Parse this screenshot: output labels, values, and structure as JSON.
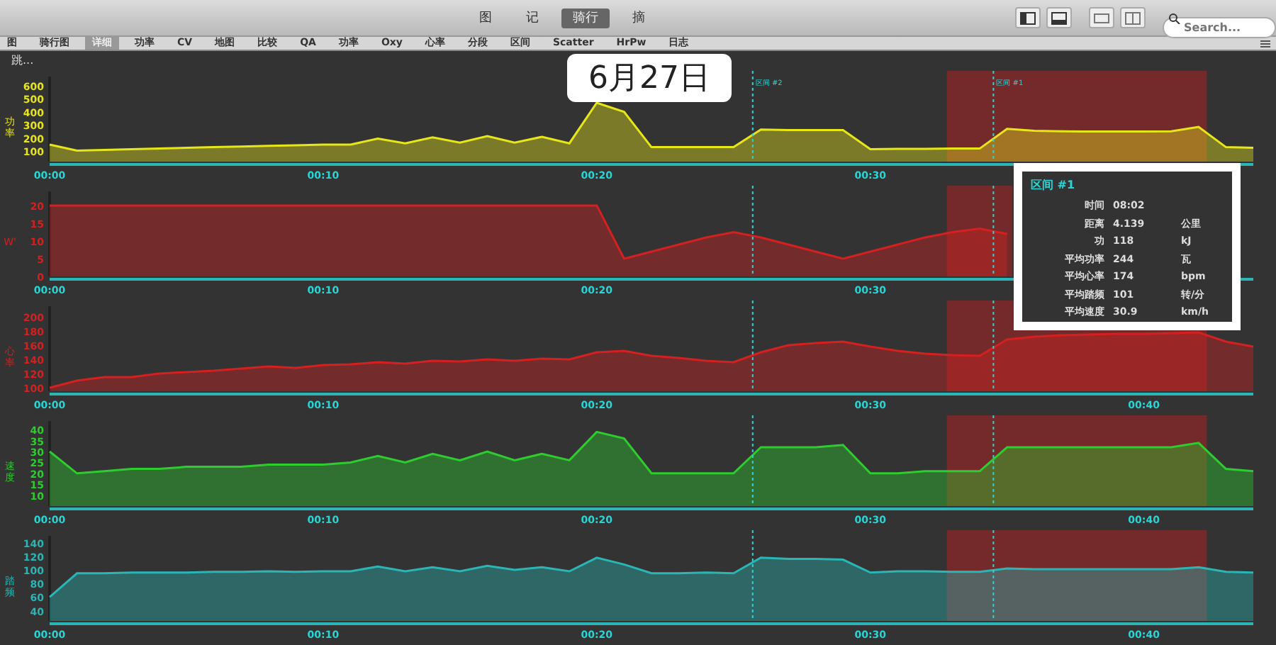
{
  "toolbar": {
    "tabs": [
      {
        "label": "图",
        "selected": false
      },
      {
        "label": "记",
        "selected": false
      },
      {
        "label": "骑行",
        "selected": true
      },
      {
        "label": "摘",
        "selected": false
      }
    ],
    "search": {
      "placeholder": "Search..."
    }
  },
  "menu_bar": {
    "items": [
      {
        "label": "图",
        "selected": false
      },
      {
        "label": "骑行图",
        "selected": false
      },
      {
        "label": "详细",
        "selected": true
      },
      {
        "label": "功率",
        "selected": false
      },
      {
        "label": "CV",
        "selected": false
      },
      {
        "label": "地图",
        "selected": false
      },
      {
        "label": "比较",
        "selected": false
      },
      {
        "label": "QA",
        "selected": false
      },
      {
        "label": "功率",
        "selected": false
      },
      {
        "label": "Oxy",
        "selected": false
      },
      {
        "label": "心率",
        "selected": false
      },
      {
        "label": "分段",
        "selected": false
      },
      {
        "label": "区间",
        "selected": false
      },
      {
        "label": "Scatter",
        "selected": false
      },
      {
        "label": "HrPw",
        "selected": false
      },
      {
        "label": "日志",
        "selected": false
      }
    ]
  },
  "status_text": "跳...",
  "date_label": "6月27日",
  "charts": [
    {
      "chart_data": {
        "type": "area",
        "x": [
          0,
          1,
          2,
          3,
          4,
          5,
          6,
          7,
          8,
          9,
          10,
          11,
          12,
          13,
          14,
          15,
          16,
          17,
          18,
          19,
          20,
          21,
          22,
          23,
          24,
          25,
          26,
          27,
          28,
          29,
          30,
          31,
          32,
          33,
          34,
          35,
          36,
          37,
          38,
          39,
          40,
          41,
          42,
          43,
          44
        ],
        "xlim": [
          0,
          44
        ],
        "ylim": [
          20,
          670
        ],
        "yticks": [
          100,
          200,
          300,
          400,
          500,
          600
        ],
        "xticks": [
          {
            "value": 0,
            "label": "00:00"
          },
          {
            "value": 10,
            "label": "00:10"
          },
          {
            "value": 20,
            "label": "00:20"
          },
          {
            "value": 30,
            "label": "00:30"
          }
        ],
        "series": [
          {
            "name": "功率",
            "color": "#e6e619",
            "values": [
              150,
              105,
              110,
              115,
              120,
              125,
              130,
              135,
              140,
              145,
              150,
              150,
              195,
              160,
              205,
              165,
              215,
              165,
              210,
              160,
              470,
              400,
              130,
              130,
              132,
              130,
              265,
              262,
              260,
              262,
              115,
              118,
              118,
              120,
              120,
              270,
              255,
              252,
              250,
              250,
              250,
              252,
              285,
              130,
              125
            ]
          }
        ],
        "bands": [
          {
            "axis": "x",
            "from": 32.8,
            "to": 42.3
          }
        ],
        "ref_lines": [
          {
            "axis": "x",
            "value": 25.7,
            "label": "区间 #2"
          },
          {
            "axis": "x",
            "value": 34.5,
            "label": "区间 #1"
          }
        ]
      }
    },
    {
      "chart_data": {
        "type": "area",
        "x": [
          0,
          1,
          2,
          3,
          4,
          5,
          6,
          7,
          8,
          9,
          10,
          11,
          12,
          13,
          14,
          15,
          16,
          17,
          18,
          19,
          20,
          21,
          22,
          23,
          24,
          25,
          26,
          27,
          28,
          29,
          30,
          31,
          32,
          33,
          34,
          35
        ],
        "xlim": [
          0,
          44
        ],
        "ylim": [
          0,
          24
        ],
        "yticks": [
          0,
          5,
          10,
          15,
          20
        ],
        "xticks": [
          {
            "value": 0,
            "label": "00:00"
          },
          {
            "value": 10,
            "label": "00:10"
          },
          {
            "value": 20,
            "label": "00:20"
          },
          {
            "value": 30,
            "label": "00:30"
          }
        ],
        "series": [
          {
            "name": "W'",
            "color": "#d42020",
            "values": [
              20,
              20,
              20,
              20,
              20,
              20,
              20,
              20,
              20,
              20,
              20,
              20,
              20,
              20,
              20,
              20,
              20,
              20,
              20,
              20,
              20,
              5,
              7,
              9,
              11,
              12.5,
              11,
              9,
              7,
              5,
              7,
              9,
              11,
              12.5,
              13.5,
              12
            ]
          }
        ],
        "bands": [
          {
            "axis": "x",
            "from": 32.8,
            "to": 35.2
          }
        ],
        "ref_lines": [
          {
            "axis": "x",
            "value": 25.7
          },
          {
            "axis": "x",
            "value": 34.5
          }
        ]
      }
    },
    {
      "chart_data": {
        "type": "area",
        "x": [
          0,
          1,
          2,
          3,
          4,
          5,
          6,
          7,
          8,
          9,
          10,
          11,
          12,
          13,
          14,
          15,
          16,
          17,
          18,
          19,
          20,
          21,
          22,
          23,
          24,
          25,
          26,
          27,
          28,
          29,
          30,
          31,
          32,
          33,
          34,
          35,
          36,
          37,
          38,
          39,
          40,
          41,
          42,
          43,
          44
        ],
        "xlim": [
          0,
          44
        ],
        "ylim": [
          95,
          215
        ],
        "yticks": [
          100,
          120,
          140,
          160,
          180,
          200
        ],
        "xticks": [
          {
            "value": 0,
            "label": "00:00"
          },
          {
            "value": 10,
            "label": "00:10"
          },
          {
            "value": 20,
            "label": "00:20"
          },
          {
            "value": 30,
            "label": "00:30"
          },
          {
            "value": 40,
            "label": "00:40"
          }
        ],
        "series": [
          {
            "name": "心率",
            "color": "#d42020",
            "values": [
              100,
              110,
              115,
              115,
              120,
              122,
              124,
              127,
              130,
              128,
              132,
              133,
              136,
              134,
              138,
              137,
              140,
              138,
              141,
              140,
              150,
              152,
              145,
              142,
              138,
              136,
              150,
              160,
              163,
              165,
              158,
              152,
              148,
              146,
              145,
              168,
              172,
              174,
              175,
              176,
              176,
              177,
              178,
              165,
              158
            ]
          }
        ],
        "bands": [
          {
            "axis": "x",
            "from": 32.8,
            "to": 42.3
          }
        ],
        "ref_lines": [
          {
            "axis": "x",
            "value": 25.7
          },
          {
            "axis": "x",
            "value": 34.5
          }
        ]
      }
    },
    {
      "chart_data": {
        "type": "area",
        "x": [
          0,
          1,
          2,
          3,
          4,
          5,
          6,
          7,
          8,
          9,
          10,
          11,
          12,
          13,
          14,
          15,
          16,
          17,
          18,
          19,
          20,
          21,
          22,
          23,
          24,
          25,
          26,
          27,
          28,
          29,
          30,
          31,
          32,
          33,
          34,
          35,
          36,
          37,
          38,
          39,
          40,
          41,
          42,
          43,
          44
        ],
        "xlim": [
          0,
          44
        ],
        "ylim": [
          5,
          44
        ],
        "yticks": [
          10,
          15,
          20,
          25,
          30,
          35,
          40
        ],
        "xticks": [
          {
            "value": 0,
            "label": "00:00"
          },
          {
            "value": 10,
            "label": "00:10"
          },
          {
            "value": 20,
            "label": "00:20"
          },
          {
            "value": 30,
            "label": "00:30"
          },
          {
            "value": 40,
            "label": "00:40"
          }
        ],
        "series": [
          {
            "name": "速度",
            "color": "#2ecc2e",
            "values": [
              30,
              20,
              21,
              22,
              22,
              23,
              23,
              23,
              24,
              24,
              24,
              25,
              28,
              25,
              29,
              26,
              30,
              26,
              29,
              26,
              39,
              36,
              20,
              20,
              20,
              20,
              32,
              32,
              32,
              33,
              20,
              20,
              21,
              21,
              21,
              32,
              32,
              32,
              32,
              32,
              32,
              32,
              34,
              22,
              21
            ]
          }
        ],
        "bands": [
          {
            "axis": "x",
            "from": 32.8,
            "to": 42.3
          }
        ],
        "ref_lines": [
          {
            "axis": "x",
            "value": 25.7
          },
          {
            "axis": "x",
            "value": 34.5
          }
        ]
      }
    },
    {
      "chart_data": {
        "type": "area",
        "x": [
          0,
          1,
          2,
          3,
          4,
          5,
          6,
          7,
          8,
          9,
          10,
          11,
          12,
          13,
          14,
          15,
          16,
          17,
          18,
          19,
          20,
          21,
          22,
          23,
          24,
          25,
          26,
          27,
          28,
          29,
          30,
          31,
          32,
          33,
          34,
          35,
          36,
          37,
          38,
          39,
          40,
          41,
          42,
          43,
          44
        ],
        "xlim": [
          0,
          44
        ],
        "ylim": [
          25,
          150
        ],
        "yticks": [
          40,
          60,
          80,
          100,
          120,
          140
        ],
        "xticks": [
          {
            "value": 0,
            "label": "00:00"
          },
          {
            "value": 10,
            "label": "00:10"
          },
          {
            "value": 20,
            "label": "00:20"
          },
          {
            "value": 30,
            "label": "00:30"
          },
          {
            "value": 40,
            "label": "00:40"
          }
        ],
        "series": [
          {
            "name": "踏频",
            "color": "#2bb5b5",
            "values": [
              60,
              95,
              95,
              96,
              96,
              96,
              97,
              97,
              98,
              97,
              98,
              98,
              105,
              98,
              104,
              98,
              106,
              100,
              104,
              98,
              118,
              108,
              95,
              95,
              96,
              95,
              118,
              116,
              116,
              115,
              96,
              98,
              98,
              97,
              97,
              102,
              101,
              101,
              101,
              101,
              101,
              101,
              104,
              97,
              96
            ]
          }
        ],
        "bands": [
          {
            "axis": "x",
            "from": 32.8,
            "to": 42.3
          }
        ],
        "ref_lines": [
          {
            "axis": "x",
            "value": 25.7
          },
          {
            "axis": "x",
            "value": 34.5
          }
        ]
      }
    }
  ],
  "tooltip": {
    "title": "区间 #1",
    "rows": [
      {
        "label": "时间",
        "value": "08:02"
      },
      {
        "label": "距离",
        "value": "4.139",
        "unit": "公里"
      },
      {
        "label": "功",
        "value": "118",
        "unit": "kJ"
      },
      {
        "label": "平均功率",
        "value": "244",
        "unit": "瓦"
      },
      {
        "label": "平均心率",
        "value": "174",
        "unit": "bpm"
      },
      {
        "label": "平均踏频",
        "value": "101",
        "unit": "转/分"
      },
      {
        "label": "平均速度",
        "value": "30.9",
        "unit": "km/h"
      }
    ]
  }
}
